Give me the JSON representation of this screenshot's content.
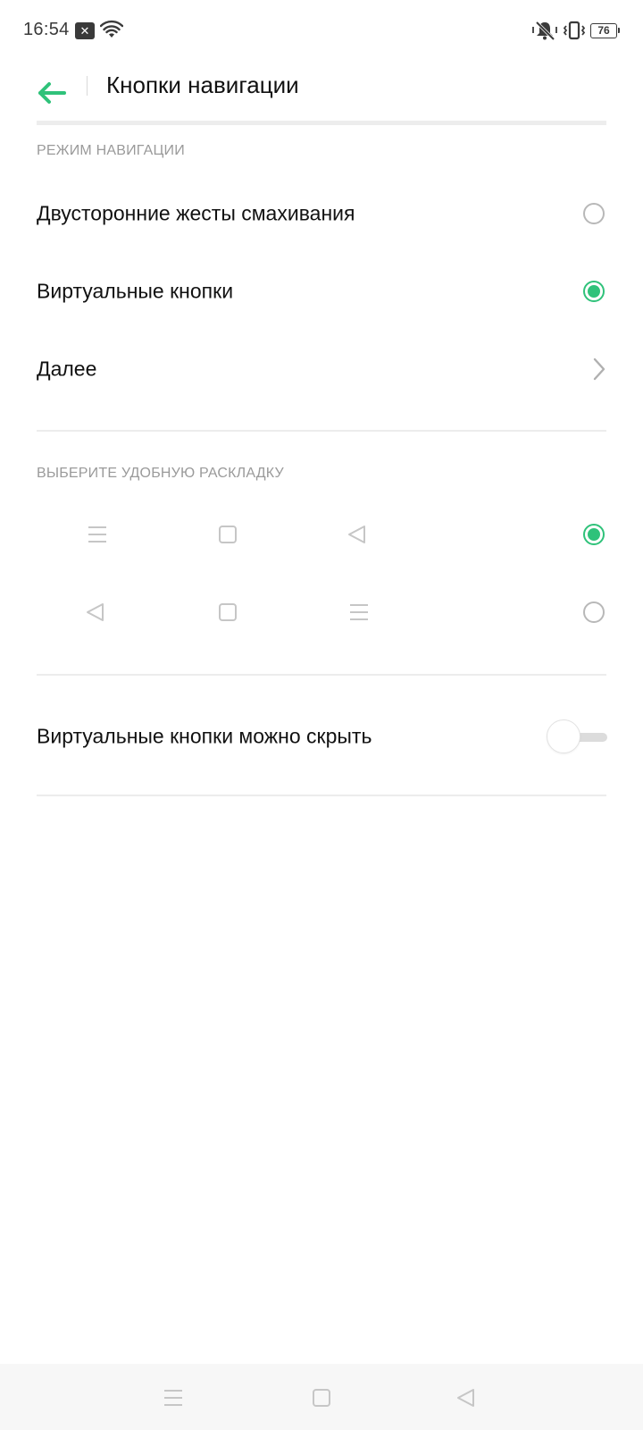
{
  "status_bar": {
    "time": "16:54",
    "notification_icon": "close-notification-icon",
    "wifi_icon": "wifi-icon",
    "mute_icon": "mute-bell-icon",
    "vibrate_icon": "vibrate-icon",
    "battery_level": "76"
  },
  "header": {
    "back_icon": "arrow-left-icon",
    "title": "Кнопки навигации",
    "accent_color": "#2fc27a"
  },
  "navigation_mode": {
    "section_title": "РЕЖИМ НАВИГАЦИИ",
    "options": [
      {
        "label": "Двусторонние жесты смахивания",
        "selected": false
      },
      {
        "label": "Виртуальные кнопки",
        "selected": true
      }
    ],
    "more": {
      "label": "Далее",
      "icon": "chevron-right-icon"
    }
  },
  "layout": {
    "section_title": "ВЫБЕРИТЕ УДОБНУЮ РАСКЛАДКУ",
    "options": [
      {
        "keys": [
          "menu-icon",
          "home-square-icon",
          "back-triangle-icon"
        ],
        "selected": true
      },
      {
        "keys": [
          "back-triangle-icon",
          "home-square-icon",
          "menu-icon"
        ],
        "selected": false
      }
    ]
  },
  "hide_buttons": {
    "label": "Виртуальные кнопки можно скрыть",
    "enabled": false
  },
  "system_nav": {
    "keys": [
      "menu-icon",
      "home-square-icon",
      "back-triangle-icon"
    ]
  }
}
